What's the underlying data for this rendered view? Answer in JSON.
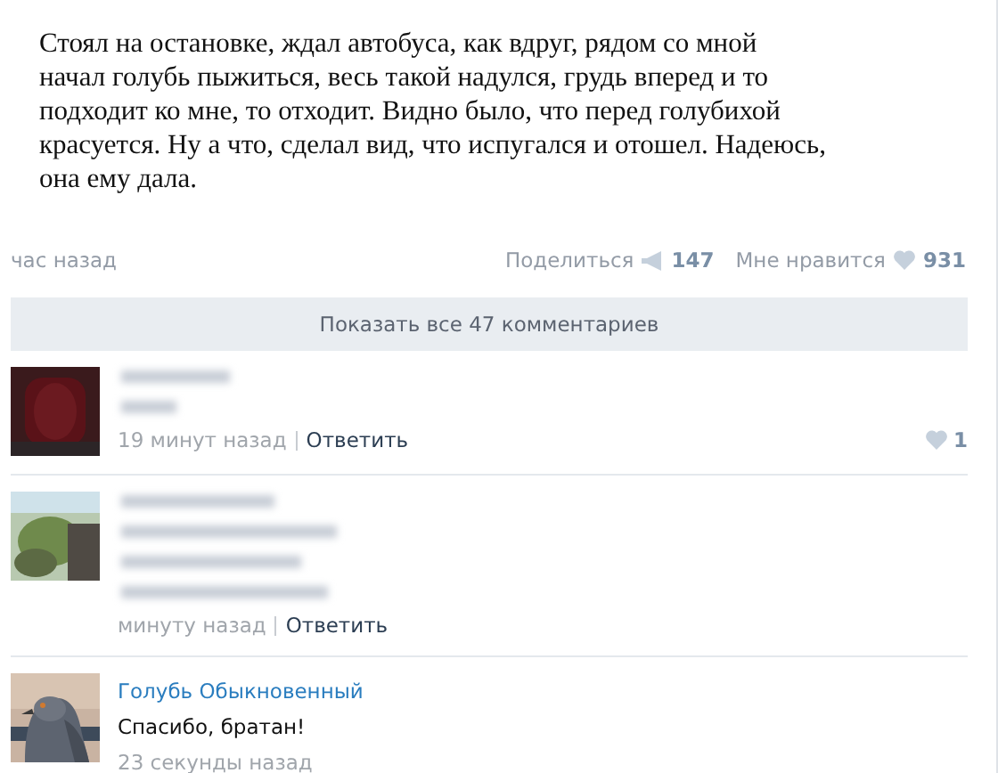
{
  "post": {
    "text": "Стоял на остановке, ждал автобуса, как вдруг, рядом со мной начал голубь пыжиться, весь такой надулся, грудь вперед и то подходит ко мне, то отходит. Видно было, что перед голубихой красуется. Ну а что, сделал вид, что испугался и отошел. Надеюсь, она ему дала."
  },
  "footer": {
    "time": "час назад",
    "share_label": "Поделиться",
    "share_count": "147",
    "like_label": "Мне нравится",
    "like_count": "931"
  },
  "show_all_button": "Показать все 47 комментариев",
  "comments": [
    {
      "kind": "blurred_short",
      "time": "19 минут назад",
      "reply": "Ответить",
      "likes": "1"
    },
    {
      "kind": "blurred_long",
      "time": "минуту назад",
      "reply": "Ответить"
    },
    {
      "kind": "normal",
      "author": "Голубь Обыкновенный",
      "text": "Спасибо, братан!",
      "time": "23 секунды назад"
    }
  ]
}
